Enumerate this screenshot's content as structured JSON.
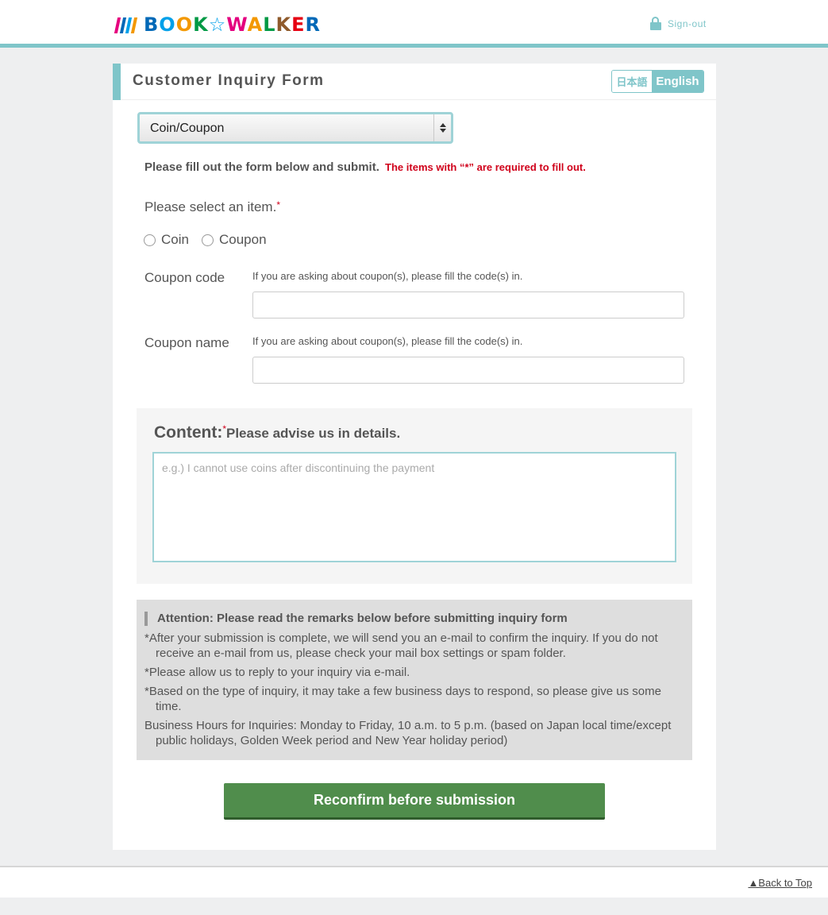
{
  "header": {
    "logo_text": "BOOK☆WALKER",
    "signout_label": "Sign-out"
  },
  "form": {
    "title": "Customer Inquiry Form",
    "lang_ja": "日本語",
    "lang_en": "English",
    "category_selected": "Coin/Coupon",
    "instruction": "Please fill out the form below and submit.",
    "required_note": "The items with “*” are required to fill out.",
    "select_item_label": "Please select an item.",
    "required_star": "*",
    "radio_options": [
      "Coin",
      "Coupon"
    ],
    "coupon_code_label": "Coupon code",
    "coupon_code_hint": "If you are asking about coupon(s), please fill the code(s) in.",
    "coupon_name_label": "Coupon name",
    "coupon_name_hint": "If you are asking about coupon(s), please fill the code(s) in.",
    "content_label": "Content:",
    "content_sub": "Please advise us in details.",
    "content_placeholder": "e.g.) I cannot use coins after discontinuing the payment",
    "attention_title": "Attention: Please read the remarks below before submitting inquiry form",
    "attention_items": [
      "*After your submission is complete, we will send you an e-mail to confirm the inquiry. If you do not receive an e-mail from us, please check your mail box settings or spam folder.",
      "*Please allow us to reply to your inquiry via e-mail.",
      "*Based on the type of inquiry, it may take a few business days to respond, so please give us some time.",
      "Business Hours for Inquiries: Monday to Friday, 10 a.m. to 5 p.m. (based on Japan local time/except public holidays, Golden Week period and New Year holiday period)"
    ],
    "submit_label": "Reconfirm before submission"
  },
  "footer": {
    "back_to_top": "▲Back to Top"
  },
  "colors": {
    "accent": "#7fc5c9",
    "submit": "#508d4c",
    "required": "#d0021b"
  }
}
